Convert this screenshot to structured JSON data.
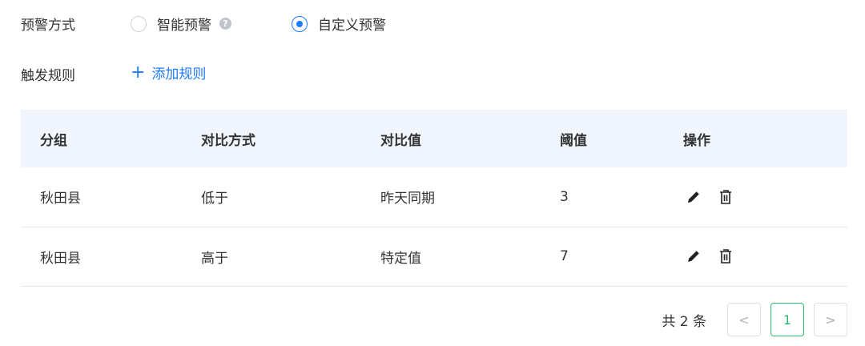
{
  "form": {
    "mode_label": "预警方式",
    "mode_options": [
      {
        "label": "智能预警",
        "checked": false,
        "has_help": true
      },
      {
        "label": "自定义预警",
        "checked": true,
        "has_help": false
      }
    ],
    "rule_label": "触发规则",
    "add_rule_icon": "+",
    "add_rule_label": "添加规则"
  },
  "table": {
    "headers": [
      "分组",
      "对比方式",
      "对比值",
      "阈值",
      "操作"
    ],
    "rows": [
      {
        "group": "秋田县",
        "compare": "低于",
        "value": "昨天同期",
        "threshold": "3"
      },
      {
        "group": "秋田县",
        "compare": "高于",
        "value": "特定值",
        "threshold": "7"
      }
    ],
    "row_actions": [
      "edit-icon",
      "delete-icon"
    ]
  },
  "pagination": {
    "total": "共 2 条",
    "prev": "<",
    "current": "1",
    "next": ">"
  },
  "colors": {
    "accent": "#1f7aff",
    "page_active": "#2fb86b",
    "header_bg": "#f1f6fe"
  }
}
